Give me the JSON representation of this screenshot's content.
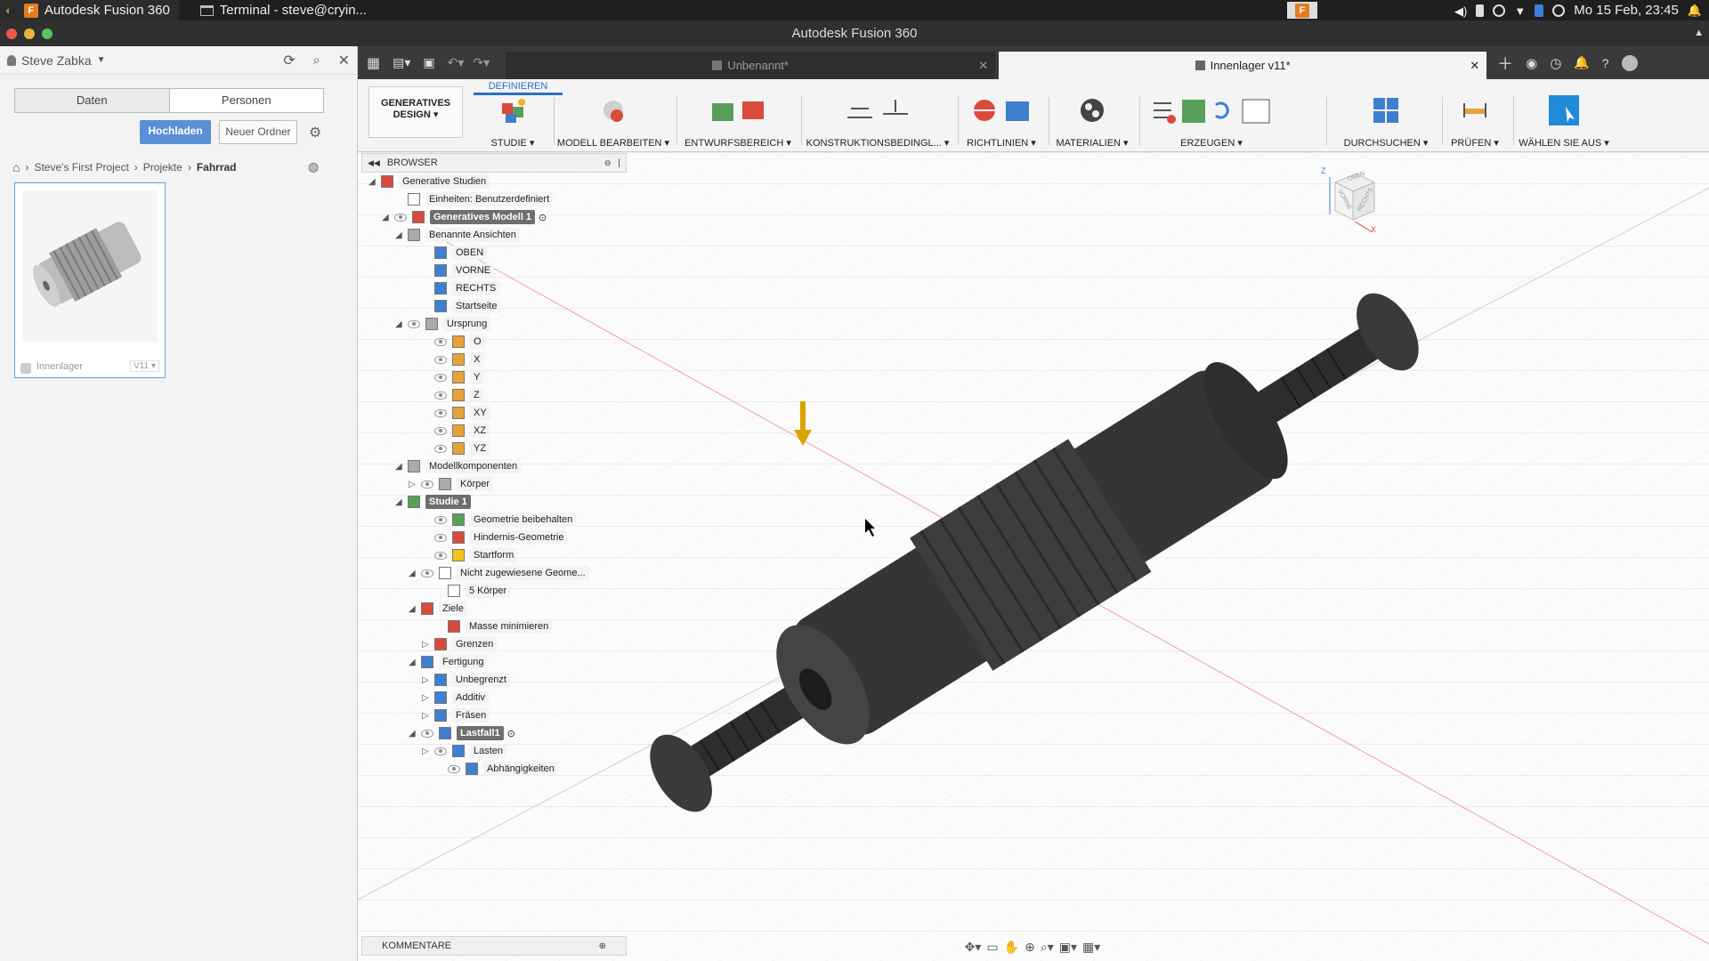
{
  "sysbar": {
    "tasks": [
      {
        "label": "Autodesk Fusion 360"
      },
      {
        "label": "Terminal - steve@cryin..."
      }
    ],
    "clock": "Mo 15 Feb, 23:45",
    "tray_icons": [
      "volume-icon",
      "battery-icon",
      "sync-icon",
      "wifi-icon",
      "bluetooth-icon",
      "vpn-icon",
      "bell-icon"
    ]
  },
  "window": {
    "title": "Autodesk Fusion 360"
  },
  "data_panel": {
    "user": "Steve Zabka",
    "tabs": [
      "Daten",
      "Personen"
    ],
    "upload_label": "Hochladen",
    "new_folder_label": "Neuer Ordner",
    "breadcrumb": [
      "Steve's First Project",
      "Projekte",
      "Fahrrad"
    ],
    "file": {
      "name": "Innenlager",
      "version": "V11"
    }
  },
  "doc_tabs": [
    {
      "label": "Unbenannt*",
      "active": false
    },
    {
      "label": "Innenlager v11*",
      "active": true
    }
  ],
  "toolbar": {
    "workspace": "GENERATIVES DESIGN",
    "section_tab": "DEFINIEREN",
    "groups": [
      "STUDIE",
      "MODELL BEARBEITEN",
      "ENTWURFSBEREICH",
      "KONSTRUKTIONSBEDINGL...",
      "RICHTLINIEN",
      "MATERIALIEN",
      "ERZEUGEN",
      "DURCHSUCHEN",
      "PRÜFEN",
      "WÄHLEN SIE AUS"
    ]
  },
  "browser": {
    "title": "BROWSER",
    "items": [
      {
        "label": "Generative Studien"
      },
      {
        "label": "Einheiten: Benutzerdefiniert"
      },
      {
        "label": "Generatives Modell 1"
      },
      {
        "label": "Benannte Ansichten"
      },
      {
        "label": "OBEN"
      },
      {
        "label": "VORNE"
      },
      {
        "label": "RECHTS"
      },
      {
        "label": "Startseite"
      },
      {
        "label": "Ursprung"
      },
      {
        "label": "O"
      },
      {
        "label": "X"
      },
      {
        "label": "Y"
      },
      {
        "label": "Z"
      },
      {
        "label": "XY"
      },
      {
        "label": "XZ"
      },
      {
        "label": "YZ"
      },
      {
        "label": "Modellkomponenten"
      },
      {
        "label": "Körper"
      },
      {
        "label": "Studie 1"
      },
      {
        "label": "Geometrie beibehalten"
      },
      {
        "label": "Hindernis-Geometrie"
      },
      {
        "label": "Startform"
      },
      {
        "label": "Nicht zugewiesene Geome..."
      },
      {
        "label": "5 Körper"
      },
      {
        "label": "Ziele"
      },
      {
        "label": "Masse minimieren"
      },
      {
        "label": "Grenzen"
      },
      {
        "label": "Fertigung"
      },
      {
        "label": "Unbegrenzt"
      },
      {
        "label": "Additiv"
      },
      {
        "label": "Fräsen"
      },
      {
        "label": "Lastfall1"
      },
      {
        "label": "Lasten"
      },
      {
        "label": "Abhängigkeiten"
      }
    ]
  },
  "comments": {
    "title": "KOMMENTARE"
  },
  "viewcube": {
    "faces": [
      "OBEN",
      "VORNE",
      "RECHTS"
    ],
    "axes": [
      "Z",
      "X"
    ]
  }
}
